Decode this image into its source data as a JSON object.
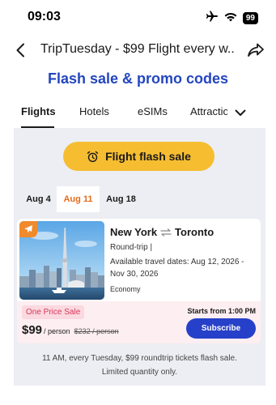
{
  "status_bar": {
    "time": "09:03",
    "battery": "99",
    "icons": [
      "airplane-mode-icon",
      "wifi-icon",
      "battery-icon"
    ]
  },
  "header": {
    "title": "TripTuesday - $99 Flight every w...",
    "back_icon": "back-chevron-icon",
    "share_icon": "share-icon"
  },
  "page_heading": "Flash sale & promo codes",
  "tabs": [
    {
      "label": "Flights",
      "active": true
    },
    {
      "label": "Hotels",
      "active": false
    },
    {
      "label": "eSIMs",
      "active": false
    },
    {
      "label": "Attractions",
      "active": false
    }
  ],
  "flash_sale_button": {
    "label": "Flight flash sale",
    "icon": "alarm-clock-icon"
  },
  "date_tabs": [
    {
      "label": "Aug 4",
      "active": false
    },
    {
      "label": "Aug 11",
      "active": true
    },
    {
      "label": "Aug 18",
      "active": false
    }
  ],
  "deal": {
    "origin": "New York",
    "destination": "Toronto",
    "trip_type": "Round-trip |",
    "travel_dates": "Available travel dates:  Aug 12, 2026  -  Nov 30, 2026",
    "cabin": "Economy",
    "badge": "One Price Sale",
    "price": "$99",
    "price_unit": "/ person",
    "old_price": "$232 / person",
    "starts_from": "Starts from 1:00 PM",
    "subscribe_label": "Subscribe",
    "image_icon": "toronto-skyline-photo",
    "badge_icon": "airplane-icon"
  },
  "footnote": {
    "line1": "11 AM, every Tuesday, $99 roundtrip tickets flash sale.",
    "line2": "Limited quantity only."
  },
  "colors": {
    "brand_blue": "#2346c0",
    "accent_yellow": "#f6bd31",
    "active_date_orange": "#e56b1a",
    "sale_pink": "#d8365a",
    "subscribe_blue": "#2640c9",
    "panel_gray": "#eceef3"
  }
}
